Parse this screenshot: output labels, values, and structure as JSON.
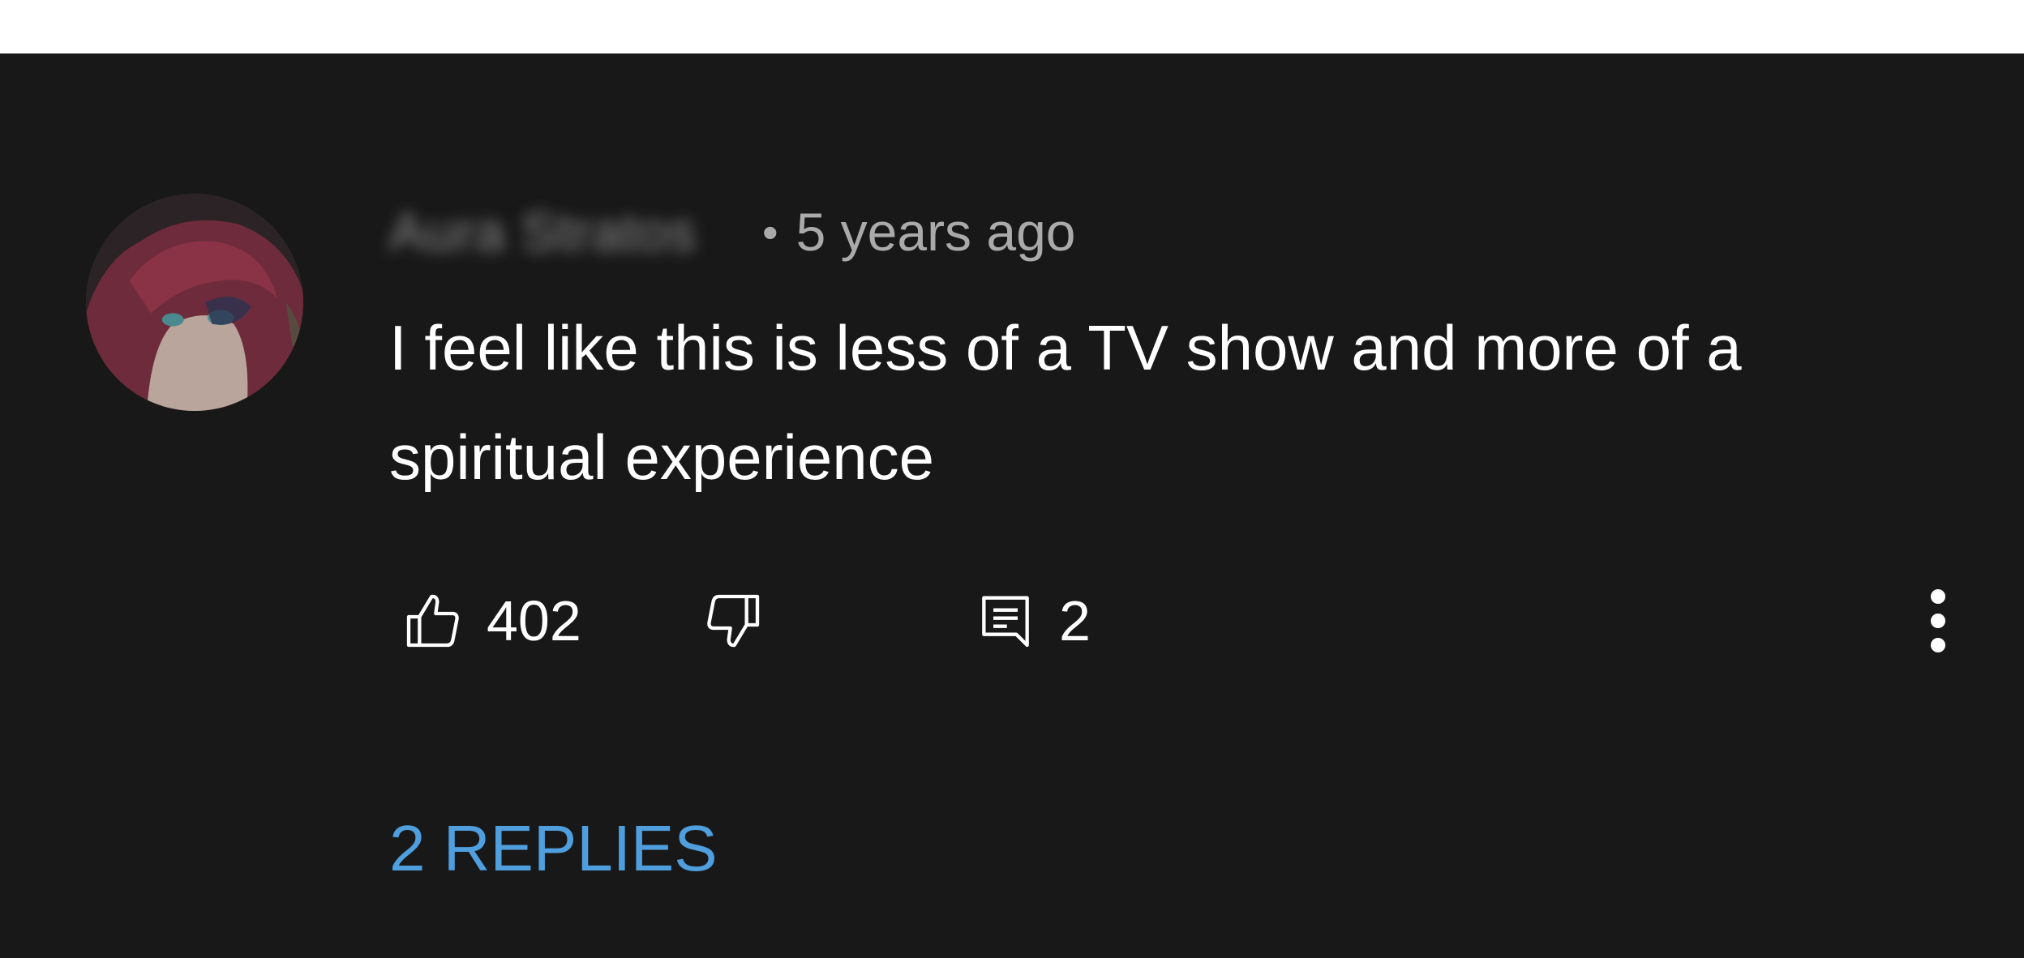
{
  "comment": {
    "author": "Aura Stratos",
    "separator": "•",
    "timestamp": "5 years ago",
    "text": "I feel like this is less of a TV show and more of a spiritual experience",
    "avatar_icon": "anime-character-avatar",
    "likes": "402",
    "replies_count": "2",
    "replies_link": "2 REPLIES"
  },
  "icons": {
    "like": "thumbs-up-icon",
    "dislike": "thumbs-down-icon",
    "reply": "comment-icon",
    "more": "more-vertical-icon"
  },
  "colors": {
    "background": "#181818",
    "text": "#ffffff",
    "meta": "#aaaaaa",
    "link": "#4f9fdf"
  }
}
